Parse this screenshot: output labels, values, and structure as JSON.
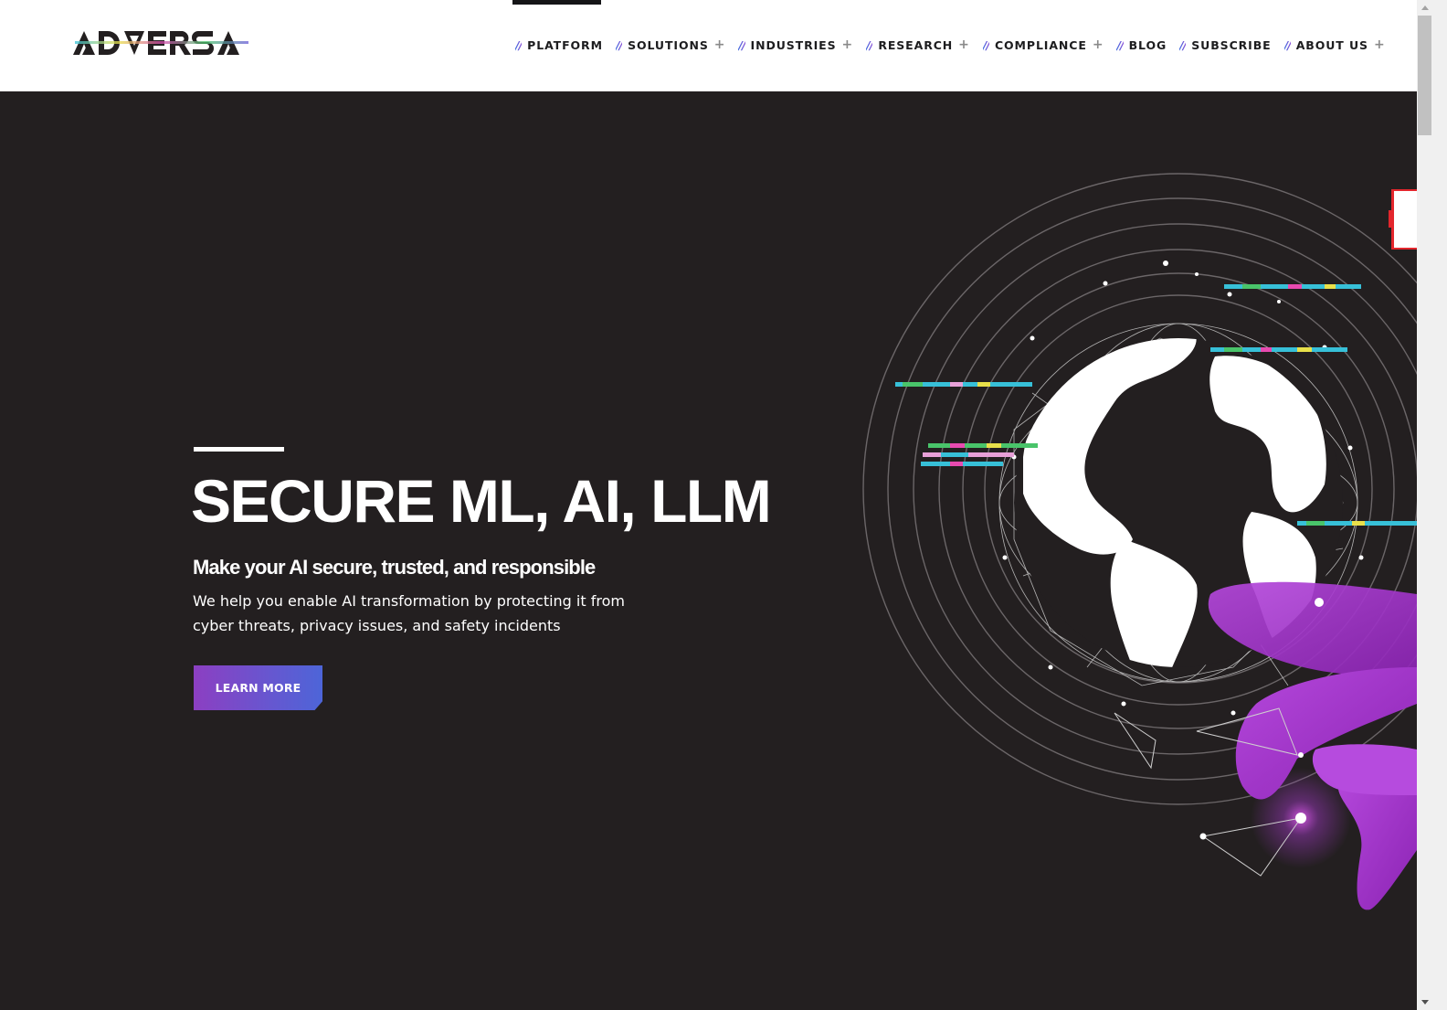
{
  "brand": {
    "name": "ADVERSA"
  },
  "nav": {
    "items": [
      {
        "label": "PLATFORM",
        "has_submenu": false,
        "active": true
      },
      {
        "label": "SOLUTIONS",
        "has_submenu": true
      },
      {
        "label": "INDUSTRIES",
        "has_submenu": true
      },
      {
        "label": "RESEARCH",
        "has_submenu": true
      },
      {
        "label": "COMPLIANCE",
        "has_submenu": true
      },
      {
        "label": "BLOG",
        "has_submenu": false
      },
      {
        "label": "SUBSCRIBE",
        "has_submenu": false
      },
      {
        "label": "ABOUT US",
        "has_submenu": true
      }
    ],
    "separator": "//",
    "submenu_icon": "+"
  },
  "hero": {
    "title": "SECURE ML, AI, LLM",
    "subtitle": "Make your AI secure, trusted, and responsible",
    "description": "We help you enable AI transformation by protecting it from cyber threats, privacy issues, and safety incidents",
    "cta_label": "LEARN MORE",
    "illustration": "globe-network-hand"
  },
  "colors": {
    "hero_bg": "#231f20",
    "accent_purple": "#a63ad0",
    "button_gradient_start": "#8c3fc2",
    "button_gradient_end": "#4d65d8",
    "nav_slash_blue": "#3f6ee0"
  }
}
